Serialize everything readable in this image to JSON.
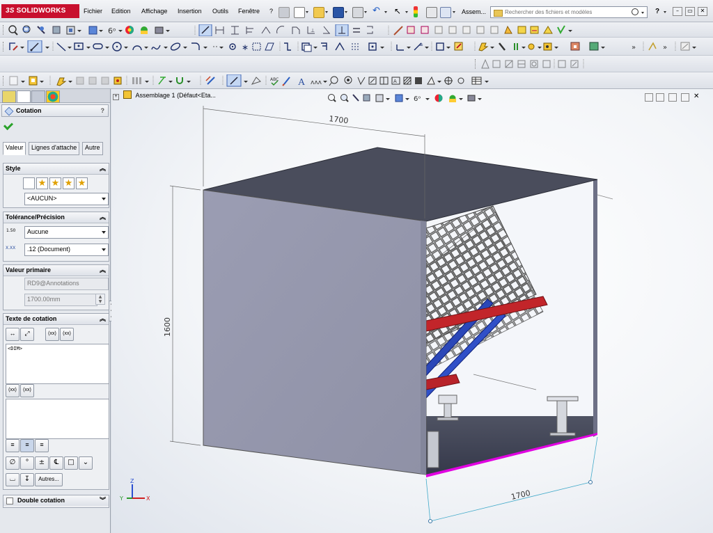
{
  "app": {
    "logo": "SOLIDWORKS",
    "logo_prefix": "3S"
  },
  "menu": {
    "items": [
      "Fichier",
      "Edition",
      "Affichage",
      "Insertion",
      "Outils",
      "Fenêtre",
      "?"
    ],
    "doc_short": "Assem...",
    "search_placeholder": "Rechercher des fichiers et modèles"
  },
  "toolbar4": {
    "more_label": "»"
  },
  "property_manager": {
    "title": "Cotation",
    "help": "?",
    "tabs": [
      "Valeur",
      "Lignes d'attache",
      "Autre"
    ],
    "style": {
      "header": "Style",
      "combo": "<AUCUN>"
    },
    "tolerance": {
      "header": "Tolérance/Précision",
      "tol_combo": "Aucune",
      "prec_combo": ".12 (Document)",
      "tol_icon_text": "1.50",
      "prec_icon_text": "X.XX"
    },
    "primary": {
      "header": "Valeur primaire",
      "name_field": "RD9@Annotations",
      "value_field": "1700.00mm"
    },
    "dim_text": {
      "header": "Texte de cotation",
      "xx1": "(xx)",
      "xx2": "(xx)",
      "main_text": "<DIM>",
      "autres": "Autres..."
    },
    "double": {
      "header": "Double cotation"
    }
  },
  "viewport": {
    "tree_label": "Assemblage 1  (Défaut<Eta...",
    "dim_top": "1700",
    "dim_left": "1600",
    "dim_bottom": "1700",
    "triad": {
      "x": "X",
      "y": "Y",
      "z": "Z"
    }
  },
  "colors": {
    "accent_red": "#c8102e",
    "selected_edge": "#e000e0",
    "box_front": "#9a9cb0",
    "box_top": "#4d5060"
  }
}
